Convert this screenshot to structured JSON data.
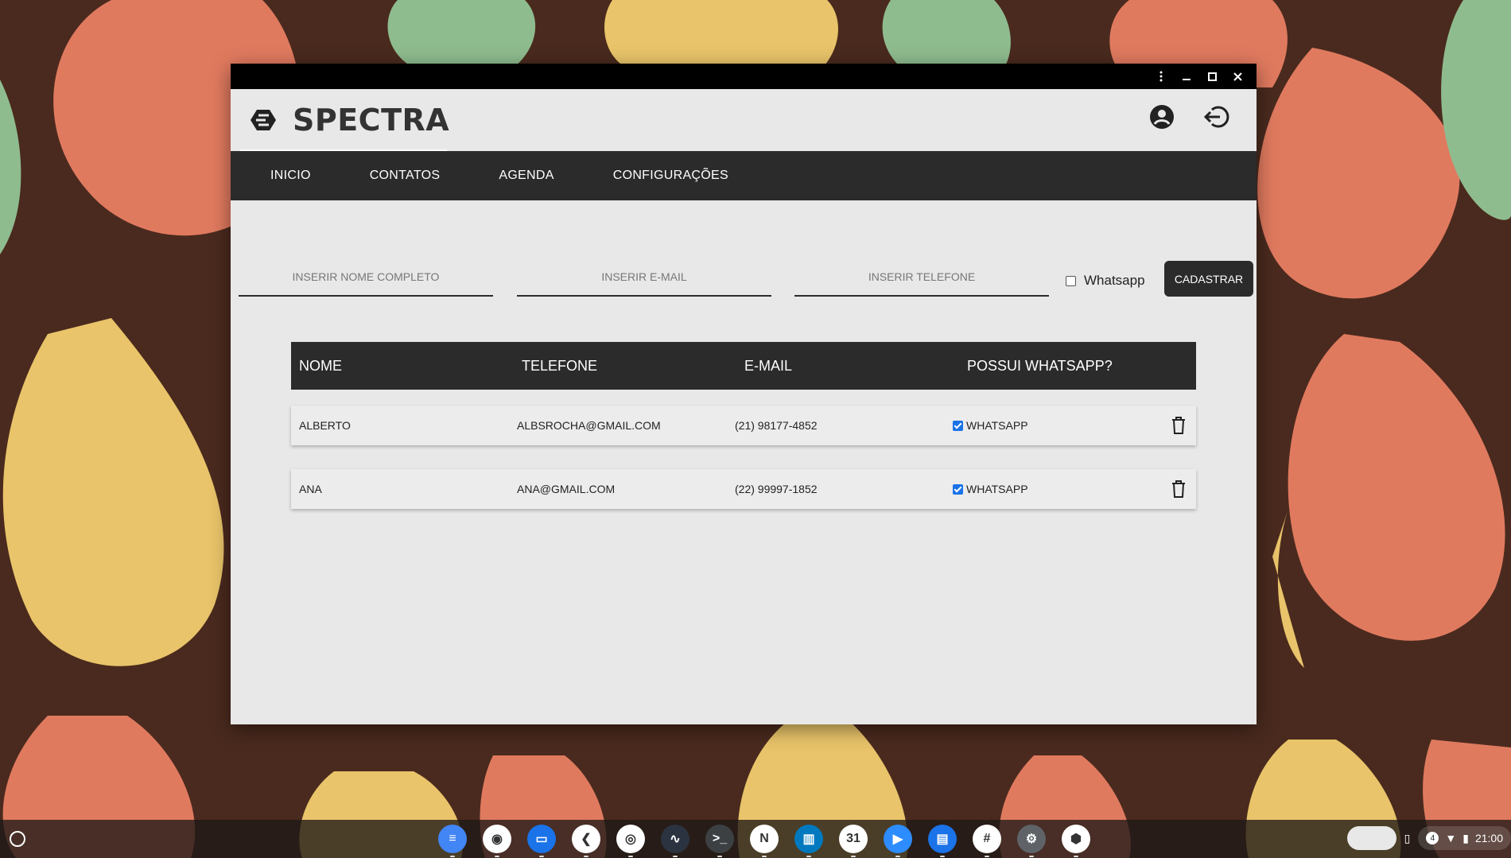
{
  "app": {
    "brand": "SPECTRA"
  },
  "nav": {
    "items": [
      "INICIO",
      "CONTATOS",
      "AGENDA",
      "CONFIGURAÇÕES"
    ]
  },
  "form": {
    "name_placeholder": "INSERIR NOME COMPLETO",
    "email_placeholder": "INSERIR E-MAIL",
    "phone_placeholder": "INSERIR TELEFONE",
    "whatsapp_label": "Whatsapp",
    "whatsapp_checked": false,
    "submit_label": "CADASTRAR"
  },
  "table": {
    "headers": [
      "NOME",
      "TELEFONE",
      "E-MAIL",
      "POSSUI WHATSAPP?"
    ],
    "rows": [
      {
        "name": "ALBERTO",
        "col2": "ALBSROCHA@GMAIL.COM",
        "col3": "(21) 98177-4852",
        "whatsapp_label": "WHATSAPP",
        "whatsapp_checked": true
      },
      {
        "name": "ANA",
        "col2": "ANA@GMAIL.COM",
        "col3": "(22) 99997-1852",
        "whatsapp_label": "WHATSAPP",
        "whatsapp_checked": true
      }
    ]
  },
  "shelf": {
    "apps": [
      {
        "icon": "docs-icon",
        "color": "#4285f4",
        "glyph": "≡"
      },
      {
        "icon": "camera-icon",
        "color": "#ffffff",
        "glyph": "◉"
      },
      {
        "icon": "files-icon",
        "color": "#1a73e8",
        "glyph": "▭"
      },
      {
        "icon": "vscode-icon",
        "color": "#ffffff",
        "glyph": "❮"
      },
      {
        "icon": "chrome-icon",
        "color": "#ffffff",
        "glyph": "◎"
      },
      {
        "icon": "stats-icon",
        "color": "#2b3340",
        "glyph": "∿"
      },
      {
        "icon": "terminal-icon",
        "color": "#3c4043",
        "glyph": ">_"
      },
      {
        "icon": "notion-icon",
        "color": "#ffffff",
        "glyph": "N"
      },
      {
        "icon": "trello-icon",
        "color": "#0079bf",
        "glyph": "▥"
      },
      {
        "icon": "calendar-icon",
        "color": "#ffffff",
        "glyph": "31"
      },
      {
        "icon": "zoom-icon",
        "color": "#2d8cff",
        "glyph": "▶"
      },
      {
        "icon": "messages-icon",
        "color": "#1a73e8",
        "glyph": "▤"
      },
      {
        "icon": "slack-icon",
        "color": "#ffffff",
        "glyph": "#"
      },
      {
        "icon": "settings-icon",
        "color": "#5f6368",
        "glyph": "⚙"
      },
      {
        "icon": "spectra-icon",
        "color": "#ffffff",
        "glyph": "⬢"
      }
    ],
    "notification_count": "4",
    "clock": "21:00"
  }
}
